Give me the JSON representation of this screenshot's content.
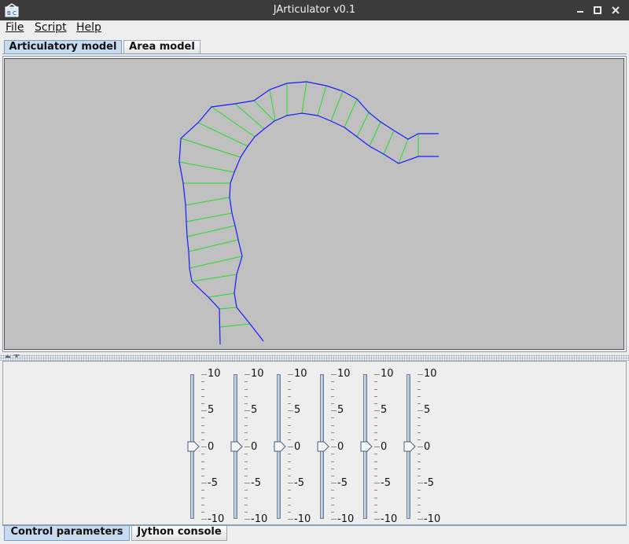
{
  "window": {
    "title": "JArticulator v0.1"
  },
  "menu": {
    "file": "File",
    "script": "Script",
    "help": "Help"
  },
  "top_tabs": [
    {
      "label": "Articulatory model",
      "selected": true
    },
    {
      "label": "Area model",
      "selected": false
    }
  ],
  "bottom_tabs": [
    {
      "label": "Control parameters",
      "selected": true
    },
    {
      "label": "Jython console",
      "selected": false
    }
  ],
  "sliders": {
    "count": 6,
    "min": -10,
    "max": 10,
    "values": [
      0,
      0,
      0,
      0,
      0,
      0
    ],
    "tick_labels": [
      "10",
      "5",
      "0",
      "-5",
      "-10"
    ]
  },
  "colors": {
    "canvas_background": "#c0c0c0",
    "tract_outline": "#1a1aff",
    "grid_lines": "#22dd22",
    "selected_tab": "#c8dbef"
  }
}
